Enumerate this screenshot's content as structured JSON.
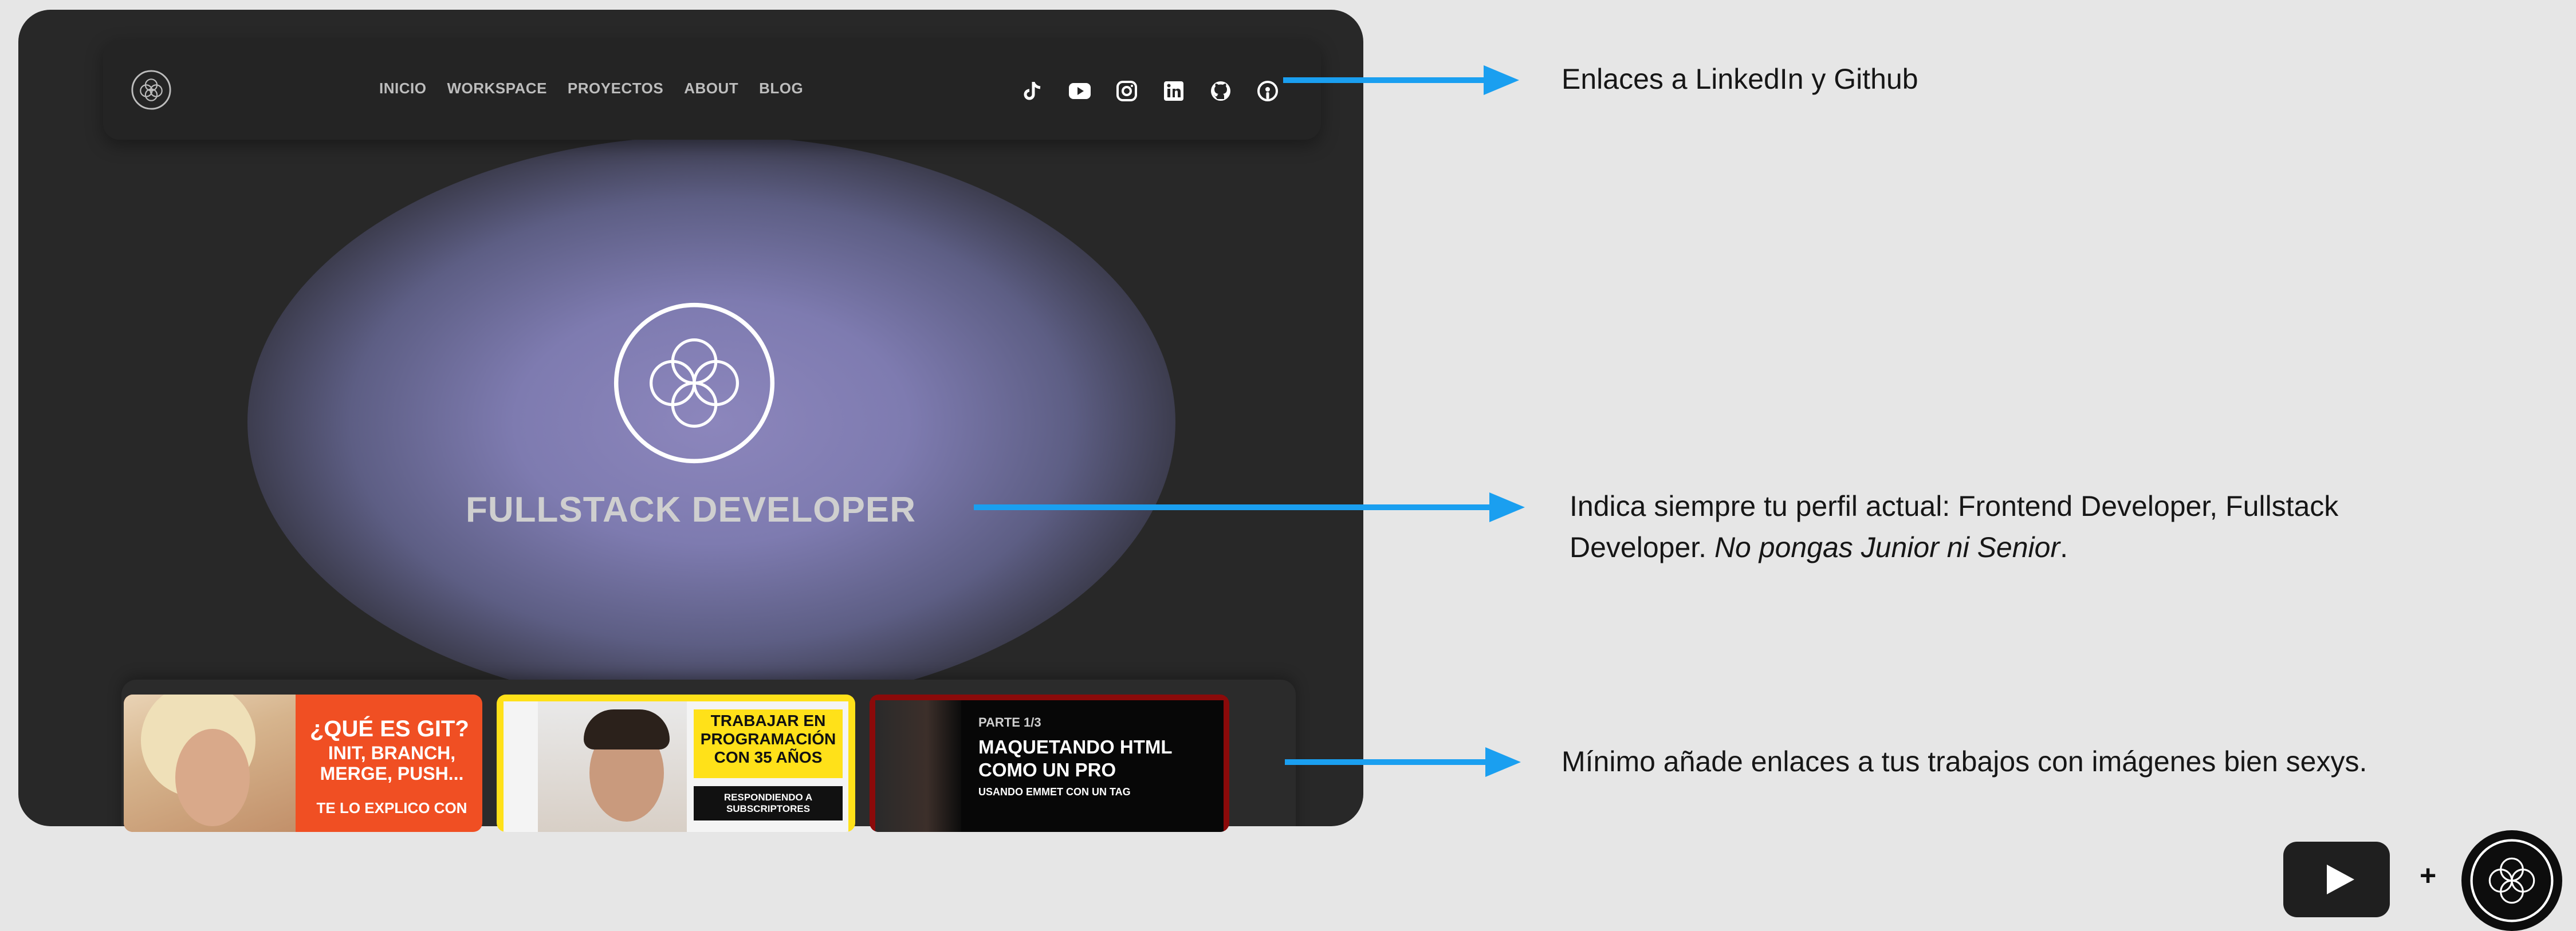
{
  "nav": {
    "links": [
      "INICIO",
      "WORKSPACE",
      "PROYECTOS",
      "ABOUT",
      "BLOG"
    ],
    "socials": [
      "tiktok-icon",
      "youtube-icon",
      "instagram-icon",
      "linkedin-icon",
      "github-icon",
      "podcast-icon"
    ]
  },
  "hero": {
    "title": "FULLSTACK DEVELOPER"
  },
  "cards": {
    "card1": {
      "title": "¿QUÉ ES GIT?",
      "subtitle": "INIT, BRANCH, MERGE, PUSH...",
      "footer": "TE LO EXPLICO CON"
    },
    "card2": {
      "title": "TRABAJAR EN PROGRAMACIÓN CON 35 AÑOS",
      "tag": "RESPONDIENDO A SUBSCRIPTORES"
    },
    "card3": {
      "part": "PARTE 1/3",
      "title": "MAQUETANDO HTML COMO UN PRO",
      "subtitle": "USANDO EMMET CON UN TAG"
    }
  },
  "annotations": {
    "links": "Enlaces a LinkedIn y Github",
    "profile_main": "Indica siempre tu perfil actual: Frontend Developer, Fullstack Developer.",
    "profile_italic": "No pongas Junior ni Senior",
    "profile_end": ".",
    "works": "Mínimo añade enlaces a tus trabajos con imágenes bien sexys."
  },
  "footer": {
    "plus": "+"
  },
  "colors": {
    "arrow": "#1a9ff0",
    "site_bg": "#282828",
    "page_bg": "#e6e6e6",
    "glow": "#8c86bc"
  }
}
